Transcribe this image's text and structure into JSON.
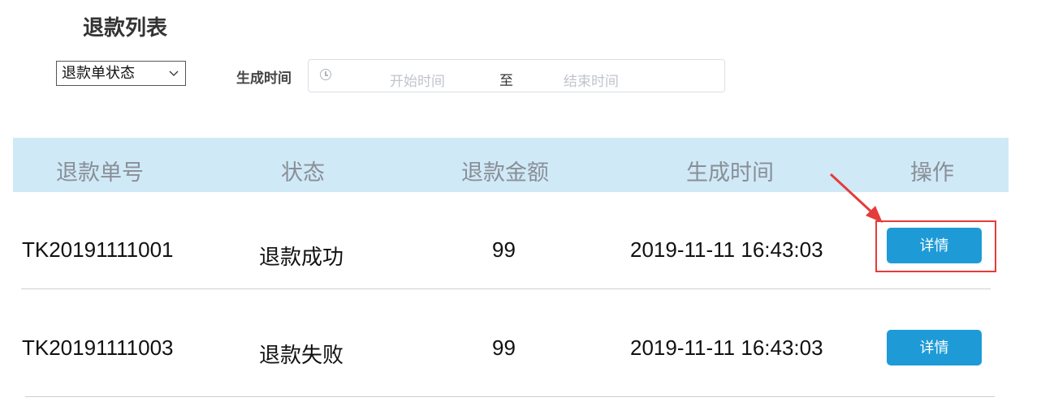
{
  "page_title": "退款列表",
  "filters": {
    "status_select_value": "退款单状态",
    "time_label": "生成时间",
    "start_placeholder": "开始时间",
    "range_separator": "至",
    "end_placeholder": "结束时间"
  },
  "table": {
    "headers": [
      "退款单号",
      "状态",
      "退款金额",
      "生成时间",
      "操作"
    ],
    "rows": [
      {
        "refund_no": "TK20191111001",
        "status": "退款成功",
        "amount": "99",
        "created": "2019-11-11 16:43:03",
        "action": "详情"
      },
      {
        "refund_no": "TK20191111003",
        "status": "退款失败",
        "amount": "99",
        "created": "2019-11-11 16:43:03",
        "action": "详情"
      }
    ]
  },
  "annotation": {
    "highlight_color": "#e63b3b"
  },
  "colors": {
    "header_bg": "#cfe9f7",
    "button": "#1e9bd7"
  }
}
